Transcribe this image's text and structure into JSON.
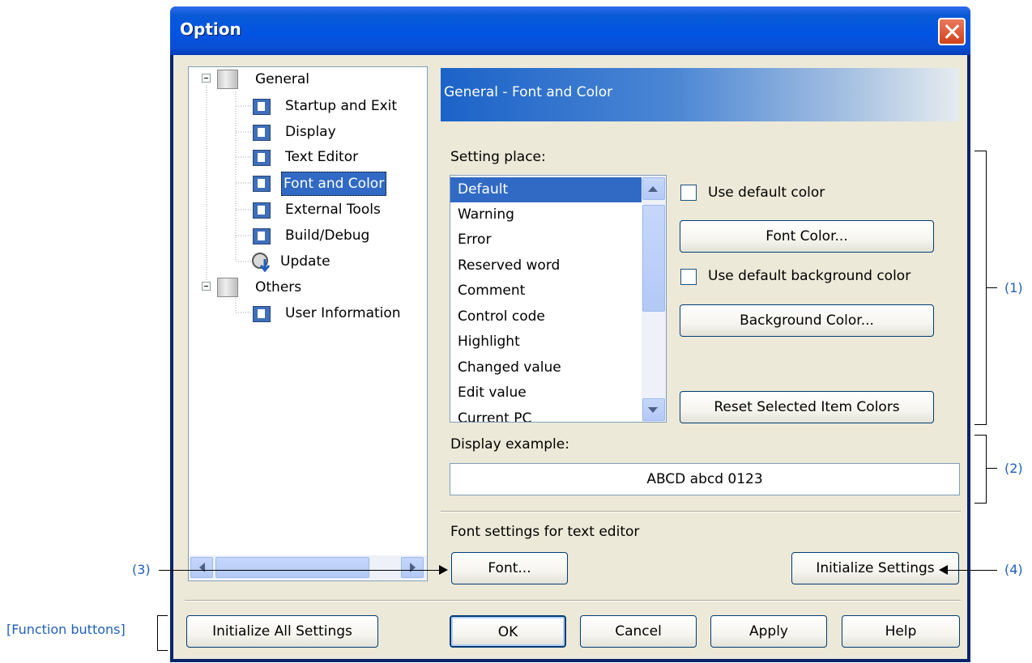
{
  "window": {
    "title": "Option"
  },
  "tree": {
    "items": [
      {
        "label": "General"
      },
      {
        "label": "Startup and Exit"
      },
      {
        "label": "Display"
      },
      {
        "label": "Text Editor"
      },
      {
        "label": "Font and Color"
      },
      {
        "label": "External Tools"
      },
      {
        "label": "Build/Debug"
      },
      {
        "label": "Update"
      },
      {
        "label": "Others"
      },
      {
        "label": "User Information"
      }
    ]
  },
  "panel": {
    "header": "General - Font and Color",
    "setting_place_label": "Setting place:",
    "setting_place_items": [
      "Default",
      "Warning",
      "Error",
      "Reserved word",
      "Comment",
      "Control code",
      "Highlight",
      "Changed value",
      "Edit value",
      "Current PC"
    ],
    "use_default_color_label": "Use default color",
    "font_color_button": "Font Color...",
    "use_default_bg_label": "Use default background color",
    "background_color_button": "Background Color...",
    "reset_button": "Reset Selected Item Colors",
    "display_example_label": "Display example:",
    "display_example_text": "ABCD abcd 0123",
    "font_settings_label": "Font settings for text editor",
    "font_button": "Font...",
    "initialize_settings_button": "Initialize Settings"
  },
  "footer": {
    "initialize_all_button": "Initialize All Settings",
    "ok_button": "OK",
    "cancel_button": "Cancel",
    "apply_button": "Apply",
    "help_button": "Help"
  },
  "annotations": {
    "a1": "(1)",
    "a2": "(2)",
    "a3": "(3)",
    "a4": "(4)",
    "function_buttons": "[Function buttons]"
  },
  "colors": {
    "selection": "#316ac5",
    "titlebar": "#0054e3",
    "annotation": "#1f5fbf"
  }
}
